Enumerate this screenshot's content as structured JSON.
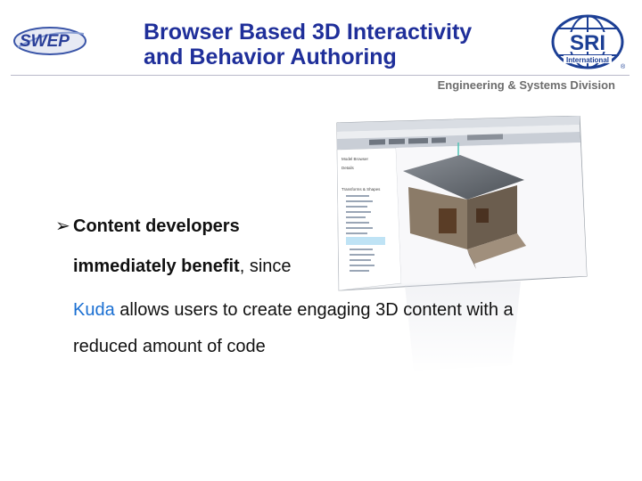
{
  "header": {
    "logo_left": "SWEP",
    "title_line1": "Browser Based 3D Interactivity",
    "title_line2": "and Behavior Authoring",
    "logo_right_main": "SRI",
    "logo_right_sub": "International",
    "division": "Engineering & Systems Division"
  },
  "body": {
    "bullet_marker": "➢",
    "bullet_bold": "Content developers",
    "line2_bold": "immediately benefit",
    "line2_rest": ", since",
    "line3_link": "Kuda",
    "line3_rest": " allows users to create engaging 3D content with a",
    "line4": "reduced amount of code"
  },
  "screenshot": {
    "panel_title": "Model Browser",
    "panel_section": "Details",
    "tree_header": "Transforms & Shapes"
  },
  "colors": {
    "title": "#1f2f9a",
    "link": "#1a6fd2",
    "division": "#6d6d6d",
    "sri_blue": "#1c3f95"
  }
}
